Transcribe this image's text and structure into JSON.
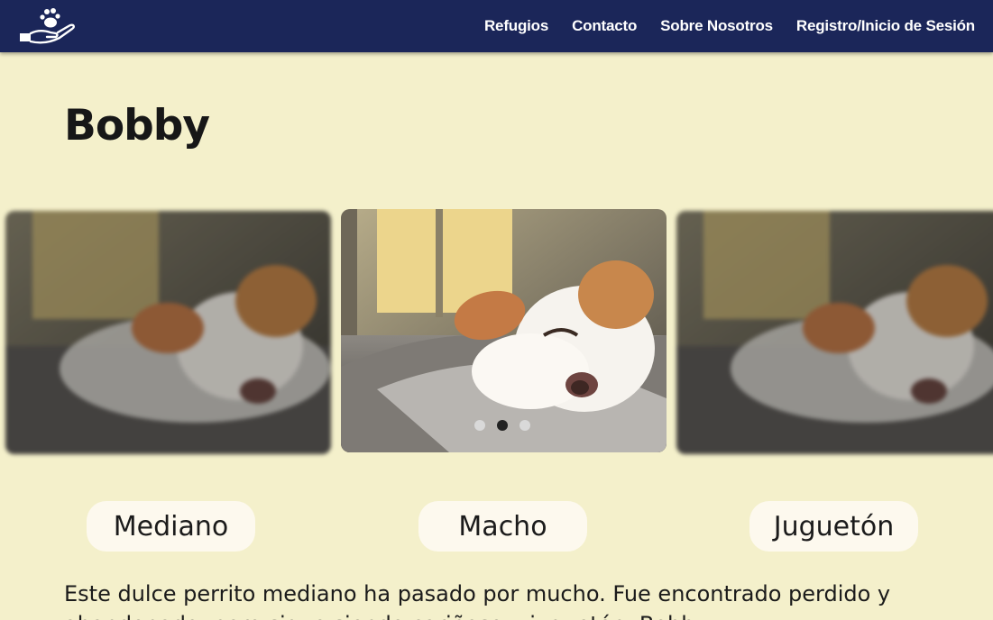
{
  "nav": {
    "logo_icon": "paw-hand-logo",
    "links": [
      "Refugios",
      "Contacto",
      "Sobre Nosotros",
      "Registro/Inicio de Sesión"
    ]
  },
  "pet": {
    "name": "Bobby",
    "traits": [
      "Mediano",
      "Macho",
      "Juguetón"
    ],
    "description": "Este dulce perrito mediano ha pasado por mucho. Fue encontrado perdido y abandonado, pero sigue siendo cariñoso y juguetón. Bobby"
  },
  "carousel": {
    "slide_count": 3,
    "active_index": 1
  },
  "colors": {
    "navbar": "#1b2659",
    "background": "#f4f0cb",
    "chip": "#fdf9ee",
    "dot_active": "#222222",
    "dot_inactive": "#d9d9d9"
  }
}
